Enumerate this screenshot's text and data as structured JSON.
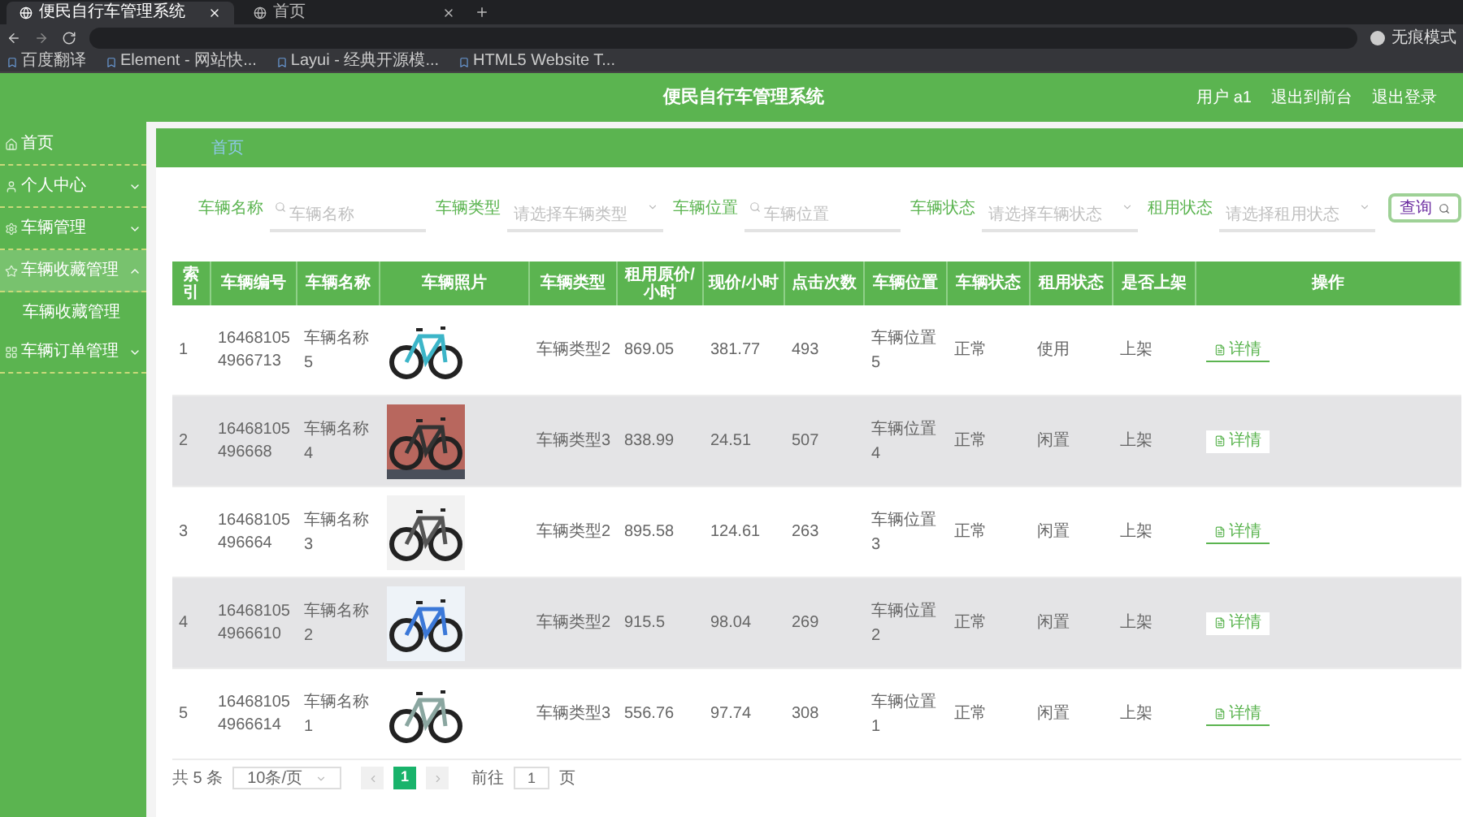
{
  "browser": {
    "tabs": [
      {
        "title": "便民自行车管理系统",
        "selected": true
      },
      {
        "title": "首页",
        "selected": false
      }
    ],
    "profile": "无痕模式",
    "bookmarks": [
      "百度翻译",
      "Element - 网站快...",
      "Layui - 经典开源模...",
      "HTML5 Website T..."
    ]
  },
  "header": {
    "title": "便民自行车管理系统",
    "links": [
      "用户 a1",
      "退出到前台",
      "退出登录"
    ]
  },
  "sidebar": {
    "items": [
      {
        "label": "首页"
      },
      {
        "label": "个人中心",
        "expanded": false
      },
      {
        "label": "车辆管理",
        "expanded": false
      },
      {
        "label": "车辆收藏管理",
        "expanded": true,
        "children": [
          {
            "label": "车辆收藏管理"
          }
        ]
      },
      {
        "label": "车辆订单管理",
        "expanded": false
      }
    ]
  },
  "breadcrumb": "首页",
  "filters": [
    {
      "label": "车辆名称",
      "kind": "search",
      "placeholder": "车辆名称"
    },
    {
      "label": "车辆类型",
      "kind": "select",
      "placeholder": "请选择车辆类型"
    },
    {
      "label": "车辆位置",
      "kind": "search",
      "placeholder": "车辆位置"
    },
    {
      "label": "车辆状态",
      "kind": "select",
      "placeholder": "请选择车辆状态"
    },
    {
      "label": "租用状态",
      "kind": "select",
      "placeholder": "请选择租用状态"
    }
  ],
  "query_button": "查询",
  "table": {
    "columns": [
      "索引",
      "车辆编号",
      "车辆名称",
      "车辆照片",
      "车辆类型",
      "租用原价/小时",
      "现价/小时",
      "点击次数",
      "车辆位置",
      "车辆状态",
      "租用状态",
      "是否上架",
      "操作"
    ],
    "rows": [
      {
        "index": "1",
        "code": "164681054966713",
        "name": "车辆名称5",
        "type": "车辆类型2",
        "price": "869.05",
        "now": "381.77",
        "clicks": "493",
        "location": "车辆位置5",
        "status": "正常",
        "rent": "使用",
        "shelf": "上架",
        "action": "详情"
      },
      {
        "index": "2",
        "code": "16468105496668",
        "name": "车辆名称4",
        "type": "车辆类型3",
        "price": "838.99",
        "now": "24.51",
        "clicks": "507",
        "location": "车辆位置4",
        "status": "正常",
        "rent": "闲置",
        "shelf": "上架",
        "action": "详情"
      },
      {
        "index": "3",
        "code": "16468105496664",
        "name": "车辆名称3",
        "type": "车辆类型2",
        "price": "895.58",
        "now": "124.61",
        "clicks": "263",
        "location": "车辆位置3",
        "status": "正常",
        "rent": "闲置",
        "shelf": "上架",
        "action": "详情"
      },
      {
        "index": "4",
        "code": "164681054966610",
        "name": "车辆名称2",
        "type": "车辆类型2",
        "price": "915.5",
        "now": "98.04",
        "clicks": "269",
        "location": "车辆位置2",
        "status": "正常",
        "rent": "闲置",
        "shelf": "上架",
        "action": "详情"
      },
      {
        "index": "5",
        "code": "164681054966614",
        "name": "车辆名称1",
        "type": "车辆类型3",
        "price": "556.76",
        "now": "97.74",
        "clicks": "308",
        "location": "车辆位置1",
        "status": "正常",
        "rent": "闲置",
        "shelf": "上架",
        "action": "详情"
      }
    ]
  },
  "pagination": {
    "total": "共 5 条",
    "page_size": "10条/页",
    "pages": [
      {
        "label": "1",
        "selected": true
      }
    ],
    "goto_label": "前往",
    "goto_value": "1",
    "goto_suffix": "页"
  }
}
